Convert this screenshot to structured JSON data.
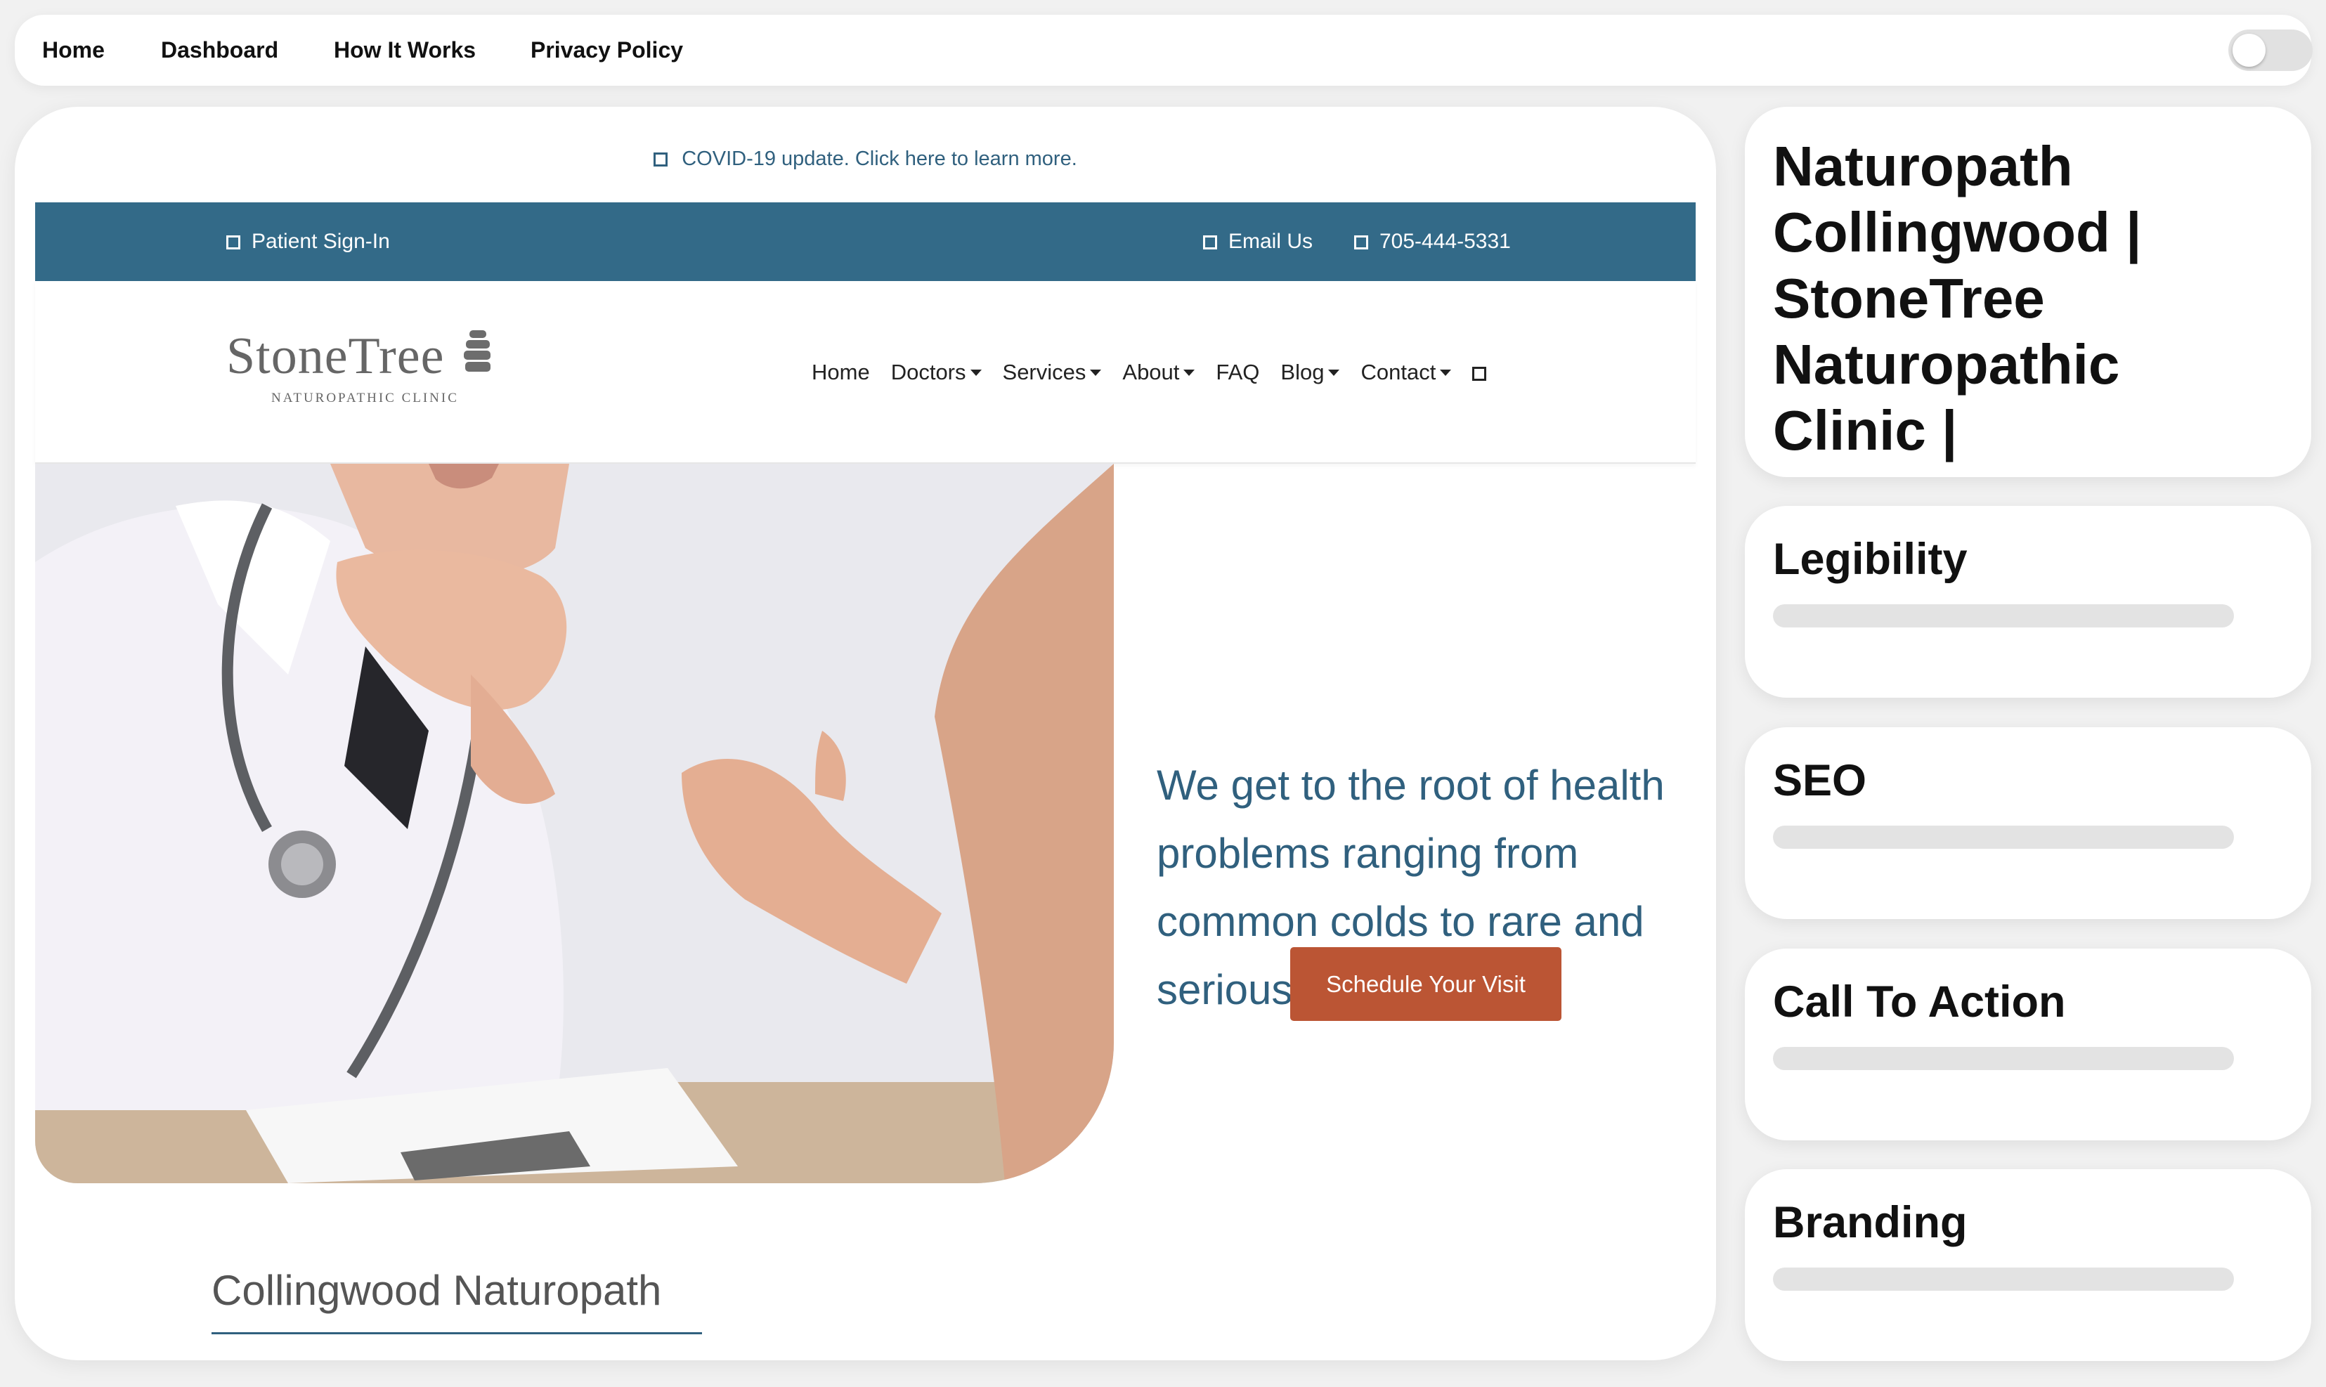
{
  "app_nav": {
    "links": [
      "Home",
      "Dashboard",
      "How It Works",
      "Privacy Policy"
    ],
    "theme_toggle_on": false
  },
  "website": {
    "covid_notice": "COVID-19 update. Click here to learn more.",
    "utility_bar": {
      "patient_signin": "Patient Sign-In",
      "email": "Email Us",
      "phone": "705-444-5331"
    },
    "logo": {
      "name": "StoneTree",
      "subtitle": "NATUROPATHIC CLINIC"
    },
    "nav": [
      {
        "label": "Home",
        "dropdown": false
      },
      {
        "label": "Doctors",
        "dropdown": true
      },
      {
        "label": "Services",
        "dropdown": true
      },
      {
        "label": "About",
        "dropdown": true
      },
      {
        "label": "FAQ",
        "dropdown": false
      },
      {
        "label": "Blog",
        "dropdown": true
      },
      {
        "label": "Contact",
        "dropdown": true
      }
    ],
    "hero": {
      "tagline": "We get to the root of health problems ranging from common colds to rare and serious conditions.",
      "cta": "Schedule Your Visit"
    },
    "section_heading": "Collingwood Naturopath"
  },
  "analysis": {
    "page_title": "Naturopath Collingwood | StoneTree Naturopathic Clinic |",
    "metrics": [
      {
        "name": "Legibility",
        "score": 0
      },
      {
        "name": "SEO",
        "score": 0
      },
      {
        "name": "Call To Action",
        "score": 0
      },
      {
        "name": "Branding",
        "score": 0
      }
    ]
  },
  "colors": {
    "brand_blue": "#336a88",
    "cta_orange": "#bb5534",
    "text_blue": "#30607e"
  }
}
